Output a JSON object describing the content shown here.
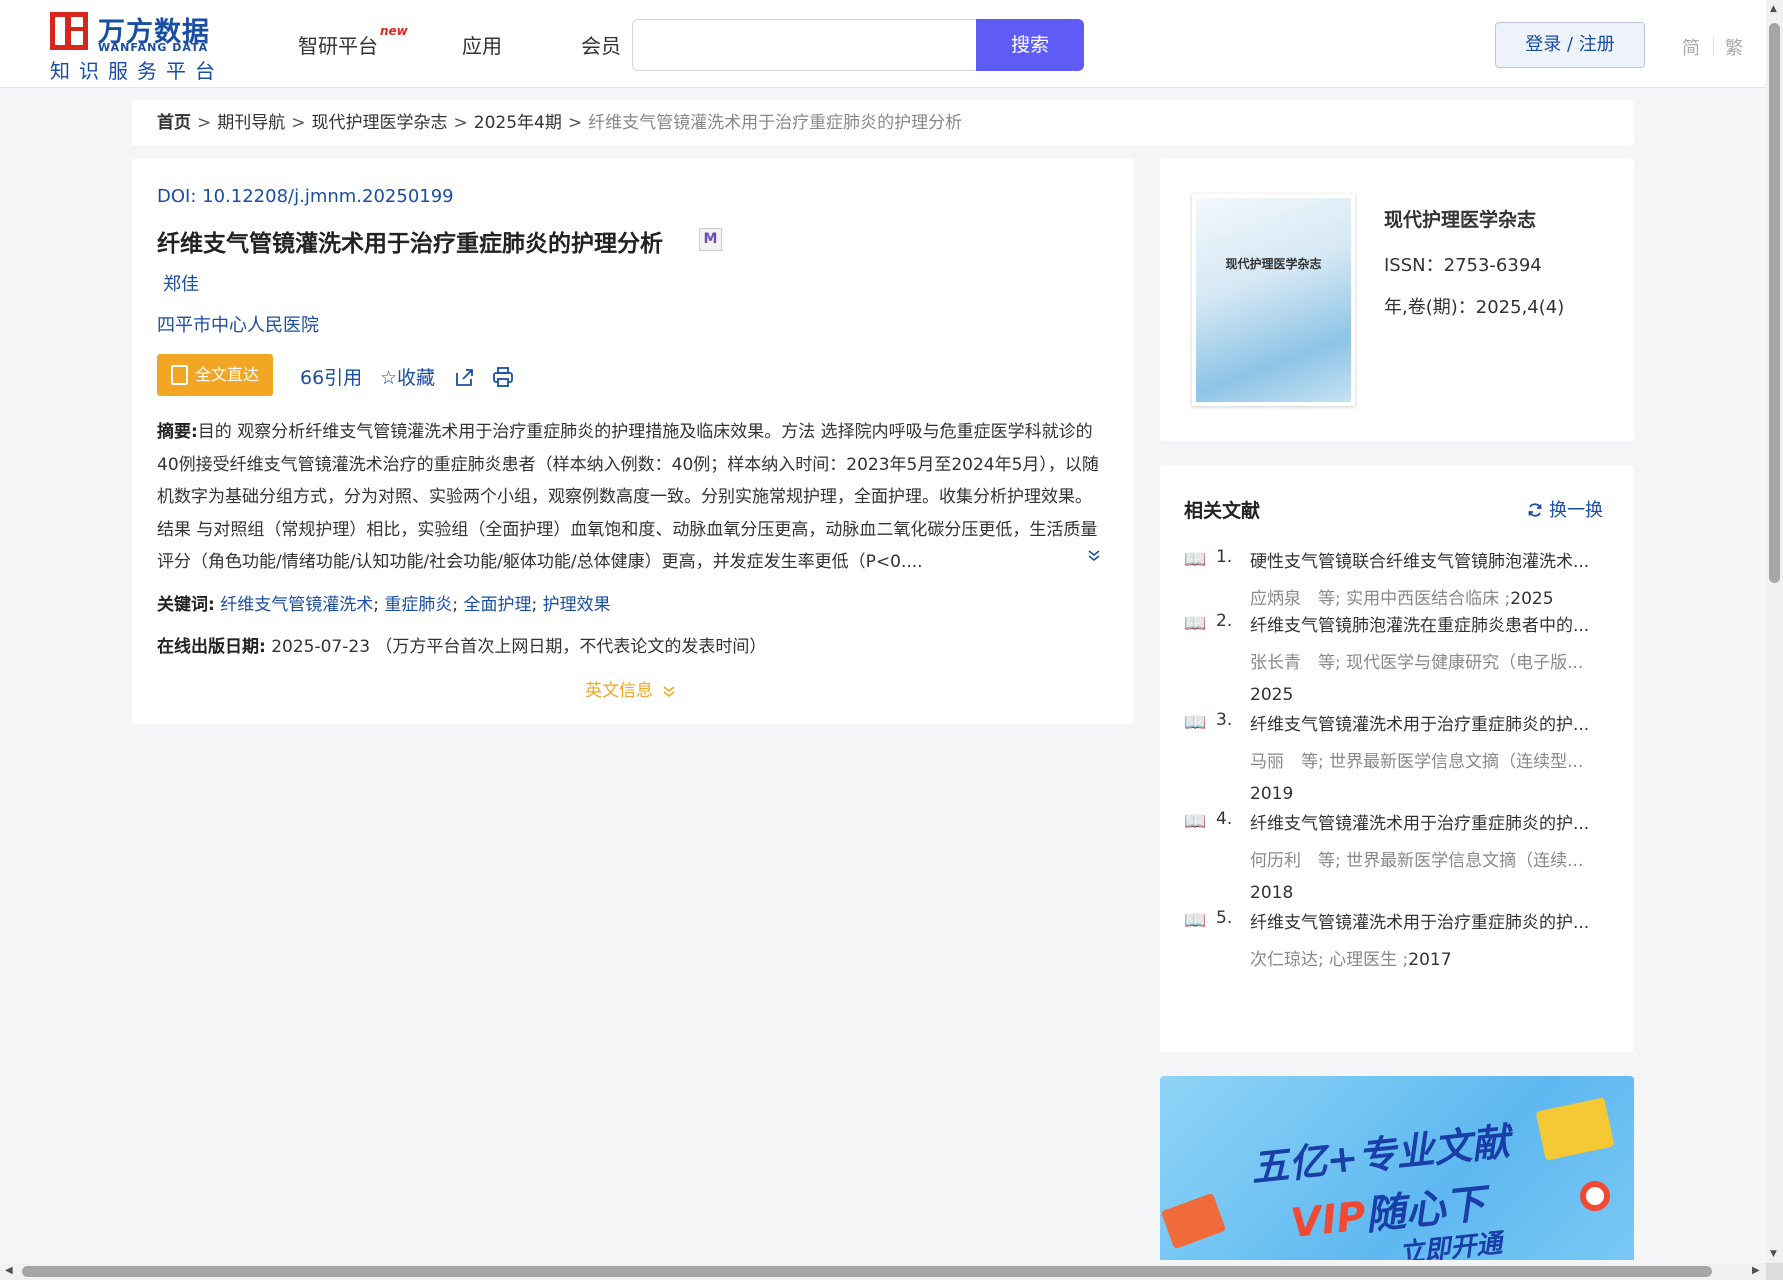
{
  "logo": {
    "cn": "万方数据",
    "en": "WANFANG DATA",
    "sub": "知识服务平台"
  },
  "nav": {
    "items": [
      "智研平台",
      "应用",
      "会员"
    ],
    "new_badge": "new"
  },
  "search": {
    "placeholder": "",
    "button": "搜索"
  },
  "login": "登录 / 注册",
  "lang": {
    "simplified": "简",
    "traditional": "繁"
  },
  "breadcrumb": {
    "home": "首页",
    "items": [
      "期刊导航",
      "现代护理医学杂志",
      "2025年4期"
    ],
    "current": "纤维支气管镜灌洗术用于治疗重症肺炎的护理分析",
    "sep": ">"
  },
  "article": {
    "doi_label": "DOI:",
    "doi": "10.12208/j.jmnm.20250199",
    "title": "纤维支气管镜灌洗术用于治疗重症肺炎的护理分析",
    "m_badge": "M",
    "author": "郑佳",
    "affiliation": "四平市中心人民医院",
    "fulltext_button": "全文直达",
    "actions": {
      "cite": "66引用",
      "favorite": "☆收藏"
    },
    "abstract_label": "摘要:",
    "abstract": "目的 观察分析纤维支气管镜灌洗术用于治疗重症肺炎的护理措施及临床效果。方法 选择院内呼吸与危重症医学科就诊的40例接受纤维支气管镜灌洗术治疗的重症肺炎患者（样本纳入例数：40例；样本纳入时间：2023年5月至2024年5月），以随机数字为基础分组方式，分为对照、实验两个小组，观察例数高度一致。分别实施常规护理，全面护理。收集分析护理效果。结果 与对照组（常规护理）相比，实验组（全面护理）血氧饱和度、动脉血氧分压更高，动脉血二氧化碳分压更低，生活质量评分（角色功能/情绪功能/认知功能/社会功能/躯体功能/总体健康）更高，并发症发生率更低（P<0....",
    "keywords_label": "关键词:",
    "keywords": [
      "纤维支气管镜灌洗术",
      "重症肺炎",
      "全面护理",
      "护理效果"
    ],
    "pubdate_label": "在线出版日期:",
    "pubdate": "2025-07-23",
    "pubdate_note": "（万方平台首次上网日期，不代表论文的发表时间）",
    "en_info": "英文信息"
  },
  "journal": {
    "cover_title": "现代护理医学杂志",
    "name": "现代护理医学杂志",
    "issn": "ISSN：2753-6394",
    "volume": "年,卷(期)：2025,4(4)"
  },
  "related": {
    "title": "相关文献",
    "refresh": "换一换",
    "items": [
      {
        "num": "1.",
        "title": "硬性支气管镜联合纤维支气管镜肺泡灌洗术...",
        "meta": "应炳泉　等;  实用中西医结合临床 ;",
        "year_inline": "2025",
        "year": ""
      },
      {
        "num": "2.",
        "title": "纤维支气管镜肺泡灌洗在重症肺炎患者中的...",
        "meta": "张长青　等;  现代医学与健康研究（电子版...",
        "year_inline": "",
        "year": "2025"
      },
      {
        "num": "3.",
        "title": "纤维支气管镜灌洗术用于治疗重症肺炎的护...",
        "meta": "马丽　等;  世界最新医学信息文摘（连续型...",
        "year_inline": "",
        "year": "2019"
      },
      {
        "num": "4.",
        "title": "纤维支气管镜灌洗术用于治疗重症肺炎的护...",
        "meta": "何历利　等;  世界最新医学信息文摘（连续...",
        "year_inline": "",
        "year": "2018"
      },
      {
        "num": "5.",
        "title": "纤维支气管镜灌洗术用于治疗重症肺炎的护...",
        "meta": "次仁琼达; 心理医生 ;",
        "year_inline": "2017",
        "year": ""
      }
    ]
  },
  "banner": {
    "line1": "五亿+专业文献",
    "line2_vip": "VIP",
    "line2_rest": "随心下",
    "line3": "立即开通"
  },
  "colors": {
    "brand": "#1a4ea3",
    "search": "#5f5cf5",
    "fulltext": "#f2a623",
    "logo_red": "#d9261c"
  }
}
